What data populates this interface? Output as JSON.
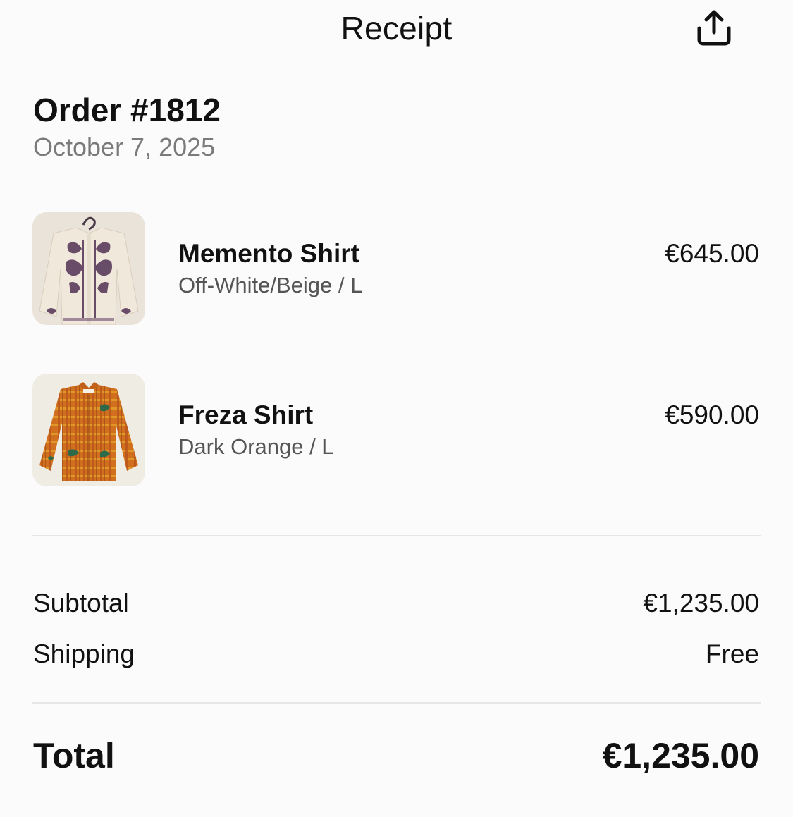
{
  "header": {
    "title": "Receipt",
    "share_icon": "share-icon"
  },
  "order": {
    "title": "Order #1812",
    "date": "October 7, 2025"
  },
  "items": [
    {
      "name": "Memento Shirt",
      "variant": "Off-White/Beige / L",
      "price": "€645.00",
      "image_icon": "embroidered-shirt-image",
      "color": "#ece4d6"
    },
    {
      "name": "Freza Shirt",
      "variant": "Dark Orange / L",
      "price": "€590.00",
      "image_icon": "plaid-shirt-image",
      "color": "#d2741f"
    }
  ],
  "summary": {
    "subtotal_label": "Subtotal",
    "subtotal_value": "€1,235.00",
    "shipping_label": "Shipping",
    "shipping_value": "Free",
    "total_label": "Total",
    "total_value": "€1,235.00"
  }
}
